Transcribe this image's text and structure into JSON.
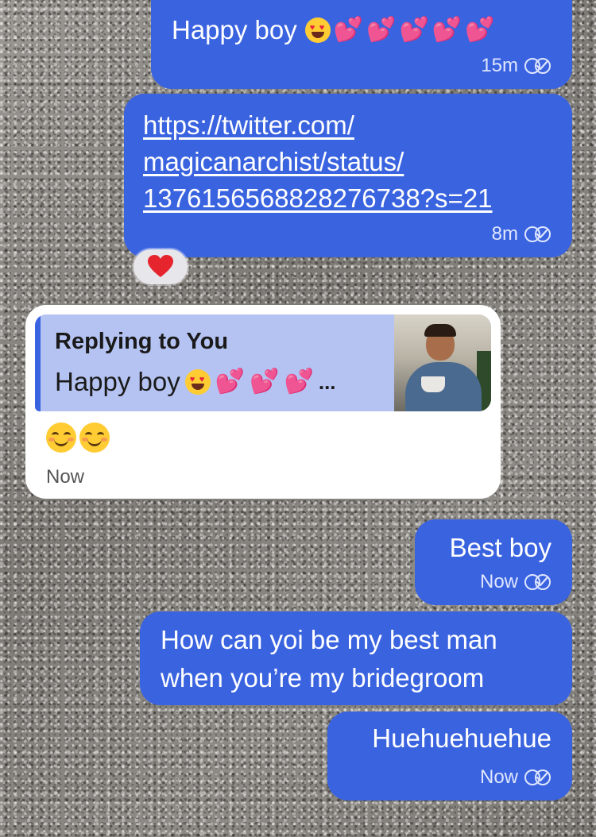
{
  "messages": [
    {
      "text": "Happy boy",
      "time": "15m"
    },
    {
      "link_lines": [
        "https://twitter.com/",
        "magicanarchist/status/",
        "1376156568828276738?s=21"
      ],
      "time": "8m",
      "reaction": "❤️"
    },
    {
      "reply_title": "Replying to You",
      "reply_text": "Happy boy",
      "reply_ellipsis": "...",
      "time": "Now"
    },
    {
      "text": "Best boy",
      "time": "Now"
    },
    {
      "lines": [
        "How can yoi be my best man",
        "when you’re my bridegroom"
      ]
    },
    {
      "text": "Huehuehuehue",
      "time": "Now"
    }
  ],
  "colors": {
    "outgoing_bubble": "#3a63e0",
    "incoming_bubble": "#ffffff",
    "quote_background": "#b5c3f3"
  },
  "icons": {
    "read_receipt": "double-check-icon",
    "reaction": "red-heart-icon"
  }
}
